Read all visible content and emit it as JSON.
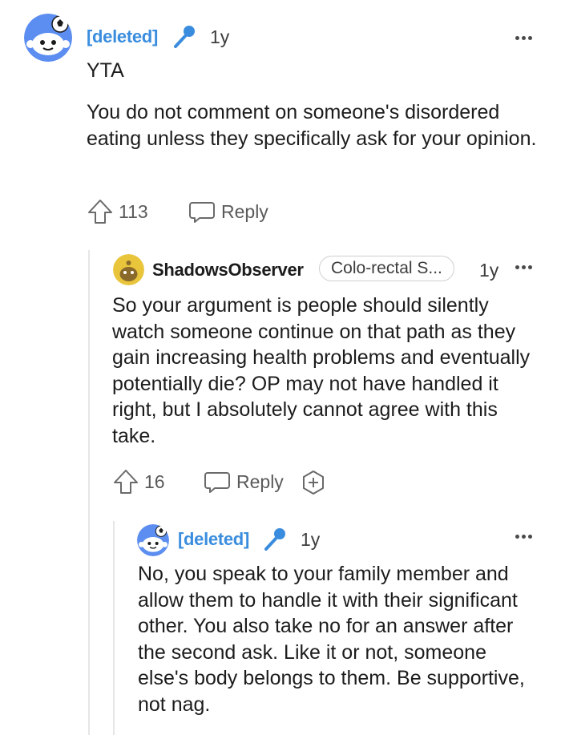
{
  "comments": [
    {
      "username": "[deleted]",
      "age": "1y",
      "paragraphs": [
        "YTA",
        "You do not comment on someone's disordered eating unless they specifically ask for your opinion."
      ],
      "upvotes": "113",
      "reply_label": "Reply",
      "username_color": "#3a8dde"
    },
    {
      "username": "ShadowsObserver",
      "flair": "Colo-rectal S...",
      "age": "1y",
      "body": "So your argument is people should silently watch someone continue on that path as they gain increasing health problems and eventually potentially die? OP may not have handled it right, but I absolutely cannot agree with this take.",
      "upvotes": "16",
      "reply_label": "Reply"
    },
    {
      "username": "[deleted]",
      "age": "1y",
      "body": "No, you speak to your family member and allow them to handle it with their significant other. You also take no for an answer after the second ask. Like it or not, someone else's body belongs to them. Be supportive, not nag."
    }
  ],
  "icons": {
    "mic": "microphone-icon",
    "upvote": "upvote-arrow-icon",
    "reply": "speech-bubble-icon",
    "award": "add-award-icon",
    "more": "more-options-icon"
  },
  "colors": {
    "link_blue": "#3a8dde",
    "avatar_blue": "#5b8ef0",
    "avatar_yellow": "#e9c53c"
  }
}
